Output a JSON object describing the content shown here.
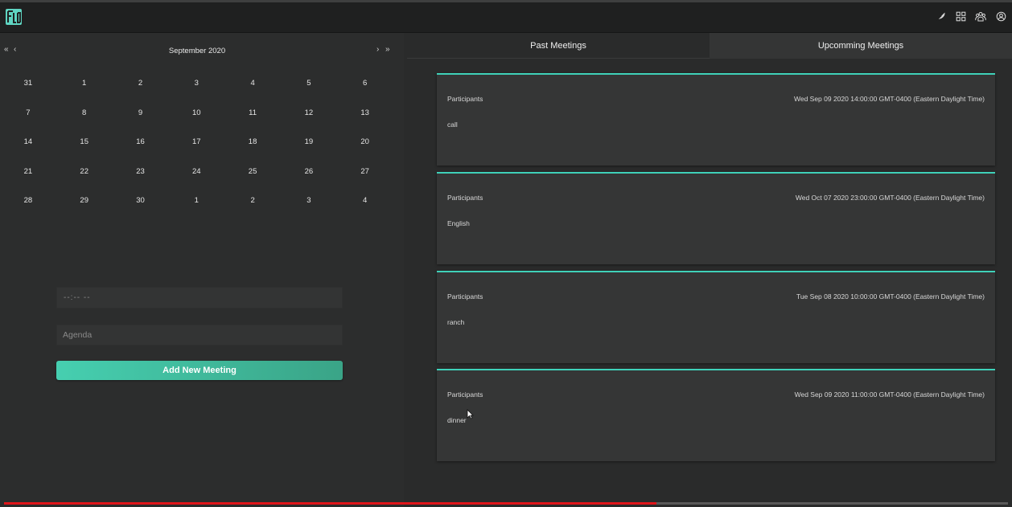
{
  "header": {
    "logo_icon": "app-logo",
    "icons": [
      "feather-icon",
      "grid-icon",
      "users-icon",
      "user-circle-icon"
    ]
  },
  "calendar": {
    "nav": {
      "prev_year": "«",
      "prev_month": "‹",
      "next_month": "›",
      "next_year": "»"
    },
    "month_label": "September 2020",
    "weeks": [
      [
        "31",
        "1",
        "2",
        "3",
        "4",
        "5",
        "6"
      ],
      [
        "7",
        "8",
        "9",
        "10",
        "11",
        "12",
        "13"
      ],
      [
        "14",
        "15",
        "16",
        "17",
        "18",
        "19",
        "20"
      ],
      [
        "21",
        "22",
        "23",
        "24",
        "25",
        "26",
        "27"
      ],
      [
        "28",
        "29",
        "30",
        "1",
        "2",
        "3",
        "4"
      ]
    ]
  },
  "form": {
    "time_placeholder": "--:-- --",
    "agenda_placeholder": "Agenda",
    "add_button": "Add New Meeting"
  },
  "tabs": {
    "past": "Past Meetings",
    "upcoming": "Upcomming Meetings"
  },
  "meetings": [
    {
      "participants": "Participants",
      "date": "Wed Sep 09 2020 14:00:00 GMT-0400 (Eastern Daylight Time)",
      "agenda": "call"
    },
    {
      "participants": "Participants",
      "date": "Wed Oct 07 2020 23:00:00 GMT-0400 (Eastern Daylight Time)",
      "agenda": "English"
    },
    {
      "participants": "Participants",
      "date": "Tue Sep 08 2020 10:00:00 GMT-0400 (Eastern Daylight Time)",
      "agenda": "ranch"
    },
    {
      "participants": "Participants",
      "date": "Wed Sep 09 2020 11:00:00 GMT-0400 (Eastern Daylight Time)",
      "agenda": "dinner"
    }
  ],
  "colors": {
    "accent": "#3fd1b9",
    "progress": "#e0161a",
    "background": "#2a2b2b"
  },
  "video_progress": 0.65
}
